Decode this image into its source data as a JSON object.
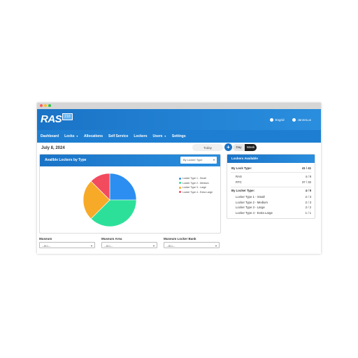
{
  "window": {
    "dots": [
      "#ff5f57",
      "#febc2e",
      "#28c840"
    ]
  },
  "header": {
    "logo_text": "RAS",
    "logo_badge": "210",
    "settings_link": "Engrid",
    "user_link": "JanneLux"
  },
  "nav": {
    "items": [
      {
        "label": "Dashboard",
        "has_caret": false
      },
      {
        "label": "Locks",
        "has_caret": true
      },
      {
        "label": "Allocations",
        "has_caret": false
      },
      {
        "label": "Self Service",
        "has_caret": false
      },
      {
        "label": "Lockers",
        "has_caret": false
      },
      {
        "label": "Users",
        "has_caret": true
      },
      {
        "label": "Settings",
        "has_caret": false
      }
    ]
  },
  "toolbar": {
    "date": "July 8, 2024",
    "today_label": "Today",
    "add_label": "+",
    "day_label": "Day",
    "week_label": "Week"
  },
  "lockers_by_type": {
    "title": "Availble Lockers by Type",
    "select_value": "By Locker Type"
  },
  "chart_data": {
    "type": "pie",
    "title": "Availble Lockers by Type",
    "series": [
      {
        "name": "Locker Type 1 - Small",
        "value": 2,
        "color": "#2b8ef0"
      },
      {
        "name": "Locker Type 2 - Medium",
        "value": 3,
        "color": "#2de09a"
      },
      {
        "name": "Locker Type 3 - Large",
        "value": 2,
        "color": "#f7a928"
      },
      {
        "name": "Locker Type 4 - Extra Large",
        "value": 1,
        "color": "#f24b5e"
      }
    ],
    "legend_position": "right"
  },
  "lockers_available": {
    "title": "Lockers Available",
    "by_lock_type_label": "By Lock Type:",
    "by_lock_type_value": "41 / 41",
    "lock_types": [
      {
        "label": "RAS",
        "value": "4 / 9"
      },
      {
        "label": "RTC",
        "value": "37 / 32"
      }
    ],
    "by_locker_type_label": "By Locker Type:",
    "by_locker_type_value": "4 / 9",
    "locker_types": [
      {
        "label": "Locker Type 1 - Small",
        "value": "2 / 3"
      },
      {
        "label": "Locker Type 2 - Medium",
        "value": "2 / 3"
      },
      {
        "label": "Locker Type 3 - Large",
        "value": "2 / 2"
      },
      {
        "label": "Locker Type 4 - Extra Large",
        "value": "1 / 1"
      }
    ]
  },
  "filters": [
    {
      "label": "Museum",
      "value": "--ALL--"
    },
    {
      "label": "Museum Area",
      "value": "--ALL--"
    },
    {
      "label": "Museum Locker Bank",
      "value": "--ALL--"
    }
  ]
}
